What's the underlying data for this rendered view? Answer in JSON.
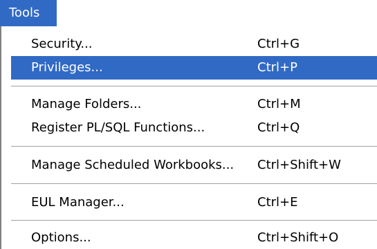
{
  "menubar": {
    "active_menu": "Tools"
  },
  "menu": {
    "items": [
      {
        "label": "Security...",
        "shortcut": "Ctrl+G"
      },
      {
        "label": "Privileges...",
        "shortcut": "Ctrl+P"
      },
      {
        "label": "Manage Folders...",
        "shortcut": "Ctrl+M"
      },
      {
        "label": "Register PL/SQL Functions...",
        "shortcut": "Ctrl+Q"
      },
      {
        "label": "Manage Scheduled Workbooks...",
        "shortcut": "Ctrl+Shift+W"
      },
      {
        "label": "EUL Manager...",
        "shortcut": "Ctrl+E"
      },
      {
        "label": "Options...",
        "shortcut": "Ctrl+Shift+O"
      }
    ],
    "highlighted_item": "Privileges..."
  },
  "colors": {
    "highlight": "#316ac5",
    "highlight_text": "#ffffff",
    "text": "#000000",
    "background": "#ffffff"
  }
}
